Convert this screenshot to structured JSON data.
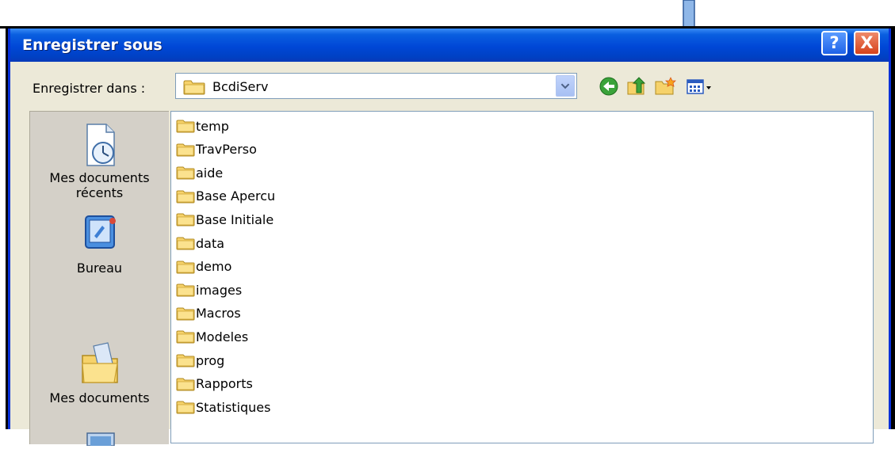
{
  "window": {
    "title": "Enregistrer sous"
  },
  "title_buttons": {
    "help": "?",
    "close": "X"
  },
  "location": {
    "label": "Enregistrer dans :",
    "value": "BcdiServ"
  },
  "places": [
    {
      "label_line1": "Mes documents",
      "label_line2": "récents",
      "icon": "recent-documents-icon"
    },
    {
      "label_line1": "Bureau",
      "icon": "desktop-icon"
    },
    {
      "label_line1": "Mes documents",
      "icon": "my-documents-icon"
    }
  ],
  "files": [
    "temp",
    "TravPerso",
    "aide",
    "Base Apercu",
    "Base Initiale",
    "data",
    "demo",
    "images",
    "Macros",
    "Modeles",
    "prog",
    "Rapports",
    "Statistiques"
  ],
  "toolbar_icons": [
    "back-icon",
    "up-folder-icon",
    "new-folder-icon",
    "view-menu-icon"
  ],
  "colors": {
    "titlebar": "#0047d6",
    "dialog_bg": "#ece9d8",
    "arrow": "#8fb7e8"
  }
}
